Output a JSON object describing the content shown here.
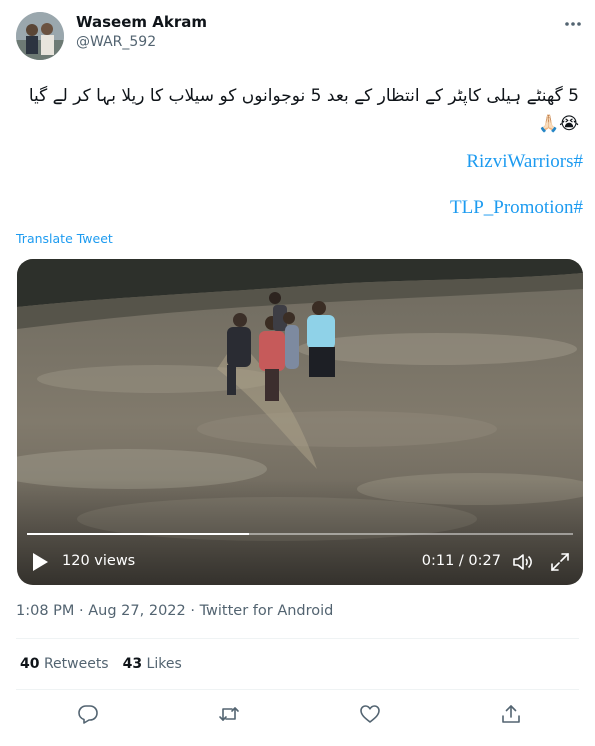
{
  "user": {
    "name": "Waseem Akram",
    "handle": "@WAR_592"
  },
  "tweet": {
    "text": "5 گھنٹے ہیلی کاپٹر کے انتظار کے بعد 5 نوجوانوں کو سیلاب کا ریلا بہا کر لے گیا😭🙏🏻",
    "hashtags": [
      "RizviWarriors#",
      "TLP_Promotion#"
    ],
    "translate_label": "Translate Tweet"
  },
  "video": {
    "views": "120 views",
    "time": "0:11 / 0:27",
    "progress_fraction": 0.407
  },
  "meta": {
    "timestamp": "1:08 PM · Aug 27, 2022 · Twitter for Android"
  },
  "stats": {
    "retweets_count": "40",
    "retweets_label": "Retweets",
    "likes_count": "43",
    "likes_label": "Likes"
  },
  "icons": {
    "more": "more-icon",
    "play": "play-icon",
    "volume": "volume-icon",
    "fullscreen": "fullscreen-icon",
    "reply": "reply-icon",
    "retweet": "retweet-icon",
    "like": "like-icon",
    "share": "share-icon"
  },
  "colors": {
    "accent": "#1d9bf0",
    "text": "#0f1419",
    "secondary": "#536471"
  }
}
